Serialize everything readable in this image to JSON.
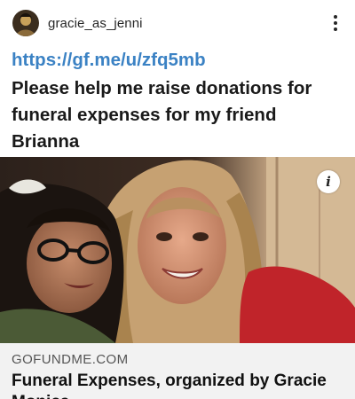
{
  "post": {
    "username": "gracie_as_jenni",
    "link": "https://gf.me/u/zfq5mb",
    "caption": "Please help me raise donations for funeral expenses for my friend Brianna"
  },
  "link_preview": {
    "domain": "GOFUNDME.COM",
    "title": "Funeral Expenses, organized by Gracie Monica"
  },
  "icons": {
    "avatar": "profile-avatar",
    "more": "vertical-ellipsis-icon",
    "info": "info-icon"
  },
  "colors": {
    "link": "#3b82c4",
    "meta_background": "#f2f2f2"
  }
}
